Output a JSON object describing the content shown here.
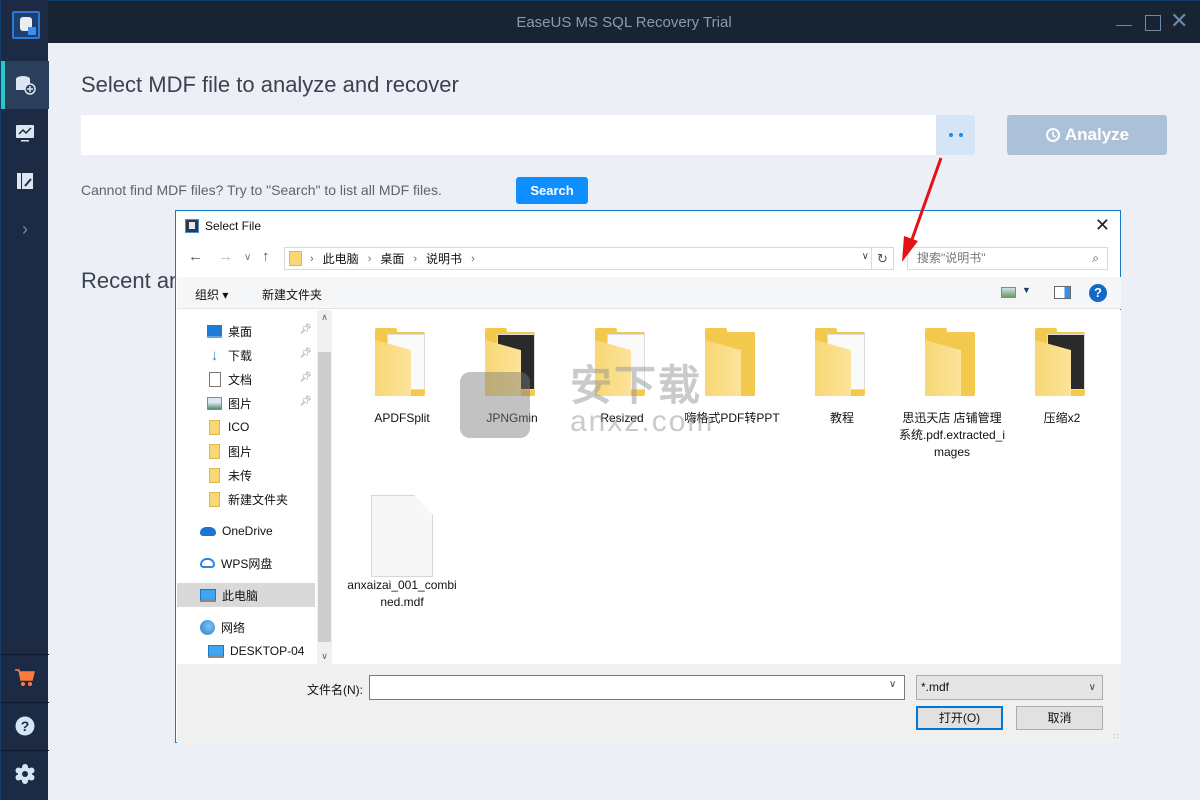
{
  "app": {
    "title": "EaseUS MS SQL Recovery Trial",
    "window_controls": [
      "minimize",
      "maximize",
      "close"
    ]
  },
  "sidebar": {
    "logo": "database-app-logo",
    "items": [
      {
        "icon": "database-add-icon",
        "active": true
      },
      {
        "icon": "monitor-chart-icon",
        "active": false
      },
      {
        "icon": "edit-log-icon",
        "active": false
      },
      {
        "icon": "chevron-right-icon",
        "active": false
      }
    ],
    "bottom_items": [
      {
        "icon": "cart-icon",
        "color": "#ff7a3d"
      },
      {
        "icon": "help-icon"
      },
      {
        "icon": "gear-icon"
      }
    ]
  },
  "main": {
    "title": "Select MDF file to analyze and recover",
    "path_value": "",
    "browse_label": "• •",
    "analyze_label": "Analyze",
    "hint": "Cannot find MDF files? Try to \"Search\" to list all MDF files.",
    "search_label": "Search",
    "recent_title": "Recent analyzed files"
  },
  "dialog": {
    "title": "Select File",
    "breadcrumb": [
      "此电脑",
      "桌面",
      "说明书"
    ],
    "search_placeholder": "搜索\"说明书\"",
    "organize_label": "组织 ▾",
    "new_folder_label": "新建文件夹",
    "nav": [
      {
        "label": "桌面",
        "icon": "desktop-icon",
        "pinned": true
      },
      {
        "label": "下载",
        "icon": "download-icon",
        "pinned": true
      },
      {
        "label": "文档",
        "icon": "document-icon",
        "pinned": true
      },
      {
        "label": "图片",
        "icon": "pictures-icon",
        "pinned": true
      },
      {
        "label": "ICO",
        "icon": "folder-icon",
        "pinned": false
      },
      {
        "label": "图片",
        "icon": "folder-icon",
        "pinned": false
      },
      {
        "label": "未传",
        "icon": "folder-icon",
        "pinned": false
      },
      {
        "label": "新建文件夹",
        "icon": "folder-icon",
        "pinned": false
      },
      {
        "label": "OneDrive",
        "icon": "onedrive-icon",
        "pinned": false
      },
      {
        "label": "WPS网盘",
        "icon": "wps-cloud-icon",
        "pinned": false
      },
      {
        "label": "此电脑",
        "icon": "this-pc-icon",
        "pinned": false,
        "selected": true
      },
      {
        "label": "网络",
        "icon": "network-icon",
        "pinned": false
      },
      {
        "label": "DESKTOP-04",
        "icon": "computer-icon",
        "pinned": false
      }
    ],
    "files": [
      {
        "name": "APDFSplit",
        "type": "folder"
      },
      {
        "name": "JPNGmin",
        "type": "folder"
      },
      {
        "name": "Resized",
        "type": "folder"
      },
      {
        "name": "嗨格式PDF转PPT",
        "type": "folder"
      },
      {
        "name": "教程",
        "type": "folder"
      },
      {
        "name": "思迅天店 店铺管理系统.pdf.extracted_images",
        "type": "folder"
      },
      {
        "name": "压缩x2",
        "type": "folder"
      },
      {
        "name": "anxaizai_001_combined.mdf",
        "type": "file"
      }
    ],
    "filename_label": "文件名(N):",
    "filename_value": "",
    "filter_value": "*.mdf",
    "open_label": "打开(O)",
    "cancel_label": "取消"
  },
  "watermark": {
    "text": "安下载",
    "sub": "anxz.com"
  }
}
